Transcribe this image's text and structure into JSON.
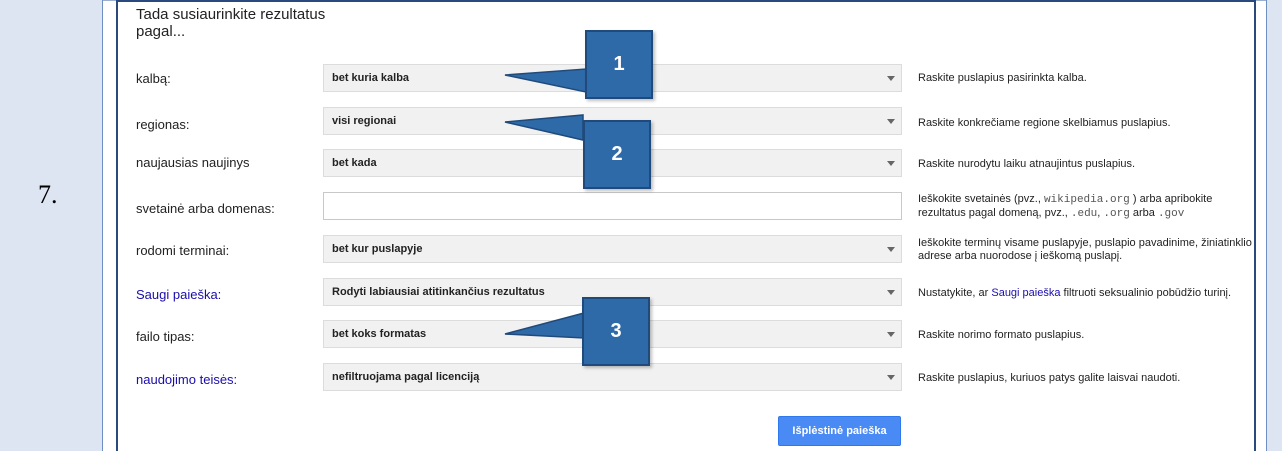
{
  "document": {
    "row_number": "7."
  },
  "form": {
    "heading": "Tada susiaurinkite rezultatus pagal...",
    "rows": [
      {
        "label": "kalbą:",
        "value": "bet kuria kalba",
        "help": "Raskite puslapius pasirinkta kalba."
      },
      {
        "label": "regionas:",
        "value": "visi regionai",
        "help": "Raskite konkrečiame regione skelbiamus puslapius."
      },
      {
        "label": "naujausias naujinys",
        "value": "bet kada",
        "help": "Raskite nurodytu laiku atnaujintus puslapius."
      },
      {
        "label": "svetainė arba domenas:",
        "value": "",
        "help_a": "Ieškokite svetainės (pvz., ",
        "help_code1": "wikipedia.org",
        "help_b": ") arba apribokite rezultatus pagal domeną, pvz., ",
        "help_code2": ".edu",
        "help_c": ", ",
        "help_code3": ".org",
        "help_d": " arba ",
        "help_code4": ".gov"
      },
      {
        "label": "rodomi terminai:",
        "value": "bet kur puslapyje",
        "help": "Ieškokite terminų visame puslapyje, puslapio pavadinime, žiniatinklio adrese arba nuorodose į ieškomą puslapį."
      },
      {
        "label": "Saugi paieška:",
        "value": "Rodyti labiausiai atitinkančius rezultatus",
        "help_a": "Nustatykite, ar ",
        "help_link": "Saugi paieška",
        "help_b": " filtruoti seksualinio pobūdžio turinį."
      },
      {
        "label": "failo tipas:",
        "value": "bet koks formatas",
        "help": "Raskite norimo formato puslapius."
      },
      {
        "label": "naudojimo teisės:",
        "value": "nefiltruojama pagal licenciją",
        "help": "Raskite puslapius, kuriuos patys galite laisvai naudoti."
      }
    ],
    "submit_label": "Išplėstinė paieška"
  },
  "callouts": [
    "1",
    "2",
    "3"
  ],
  "colors": {
    "callout": "#2f6aa8",
    "link": "#1a0dab",
    "button": "#4a8af4",
    "table_bg": "#dde5f2"
  }
}
